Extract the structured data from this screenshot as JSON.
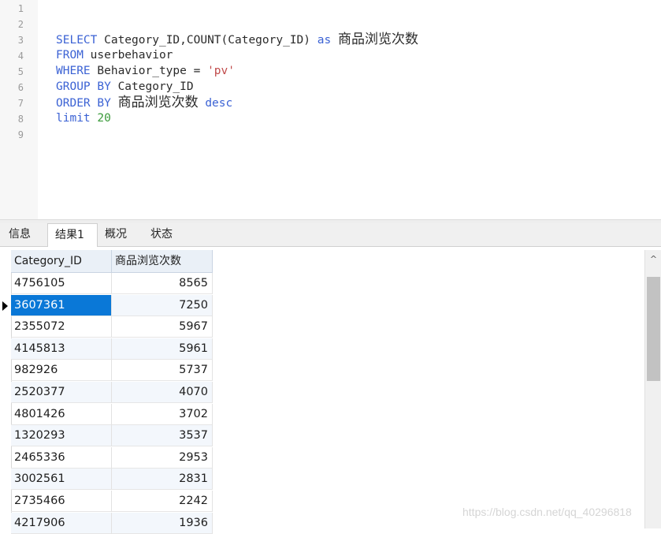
{
  "editor": {
    "line_numbers": [
      "1",
      "2",
      "3",
      "4",
      "5",
      "6",
      "7",
      "8",
      "9"
    ],
    "sql": {
      "l3_kw1": "SELECT",
      "l3_text": " Category_ID,COUNT(Category_ID) ",
      "l3_kw2": "as",
      "l3_alias": "商品浏览次数",
      "l4_kw": "FROM",
      "l4_text": " userbehavior",
      "l5_kw": "WHERE",
      "l5_text": " Behavior_type = ",
      "l5_str": "'pv'",
      "l6_kw": "GROUP BY",
      "l6_text": " Category_ID",
      "l7_kw": "ORDER BY",
      "l7_alias": "商品浏览次数",
      "l7_kw2": "desc",
      "l8_kw": "limit",
      "l8_num": "20"
    }
  },
  "tabs": [
    {
      "label": "信息"
    },
    {
      "label": "结果1"
    },
    {
      "label": "概况"
    },
    {
      "label": "状态"
    }
  ],
  "result_grid": {
    "columns": [
      "Category_ID",
      "商品浏览次数"
    ],
    "rows": [
      [
        "4756105",
        "8565"
      ],
      [
        "3607361",
        "7250"
      ],
      [
        "2355072",
        "5967"
      ],
      [
        "4145813",
        "5961"
      ],
      [
        "982926",
        "5737"
      ],
      [
        "2520377",
        "4070"
      ],
      [
        "4801426",
        "3702"
      ],
      [
        "1320293",
        "3537"
      ],
      [
        "2465336",
        "2953"
      ],
      [
        "3002561",
        "2831"
      ],
      [
        "2735466",
        "2242"
      ],
      [
        "4217906",
        "1936"
      ]
    ],
    "selected_row_index": 1
  },
  "scrollbar": {
    "up_arrow_icon": "chevron-up-icon",
    "up_glyph": "^"
  },
  "watermark": "https://blog.csdn.net/qq_40296818",
  "colors": {
    "keyword": "#3b62d4",
    "string": "#c04a4a",
    "number": "#3a9a3a",
    "selection": "#0a78d7"
  }
}
